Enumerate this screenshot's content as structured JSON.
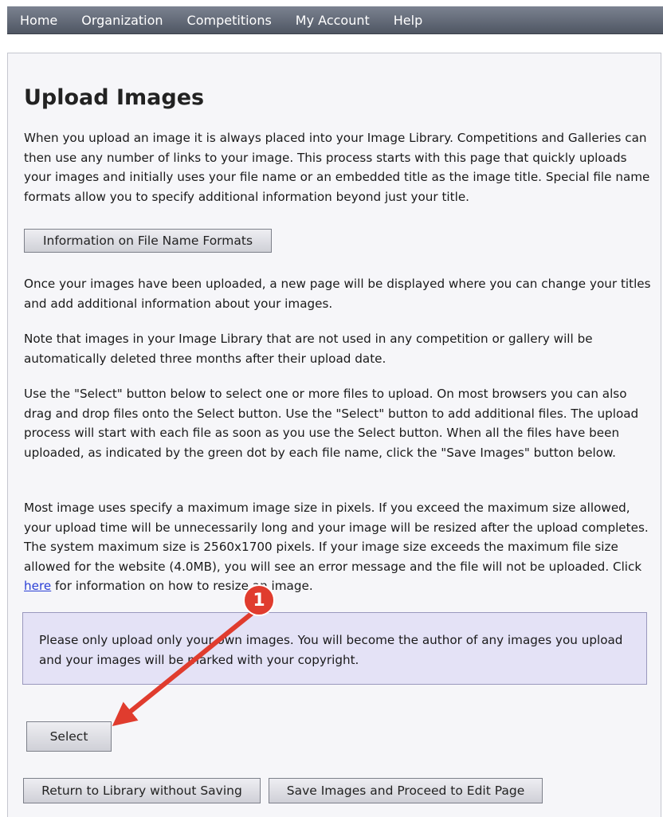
{
  "nav": {
    "items": [
      "Home",
      "Organization",
      "Competitions",
      "My Account",
      "Help"
    ]
  },
  "page": {
    "title": "Upload Images",
    "intro": "When you upload an image it is always placed into your Image Library. Competitions and Galleries can then use any number of links to your image. This process starts with this page that quickly uploads your images and initially uses your file name or an embedded title as the image title. Special file name formats allow you to specify additional information beyond just your title.",
    "info_button": "Information on File Name Formats",
    "para_uploaded": "Once your images have been uploaded, a new page will be displayed where you can change your titles and add additional information about your images.",
    "para_note_delete": "Note that images in your Image Library that are not used in any competition or gallery will be automatically deleted three months after their upload date.",
    "para_select": "Use the \"Select\" button below to select one or more files to upload. On most browsers you can also drag and drop files onto the Select button. Use the \"Select\" button to add additional files. The upload process will start with each file as soon as you use the Select button. When all the files have been uploaded, as indicated by the green dot by each file name, click the \"Save Images\" button below.",
    "para_size_before": "Most image uses specify a maximum image size in pixels. If you exceed the maximum size allowed, your upload time will be unnecessarily long and your image will be resized after the upload completes. The system maximum size is 2560x1700 pixels. If your image size exceeds the maximum file size allowed for the website (4.0MB), you will see an error message and the file will not be uploaded. Click ",
    "para_size_link": "here",
    "para_size_after": " for information on how to resize an image.",
    "notice": "Please only upload only your own images. You will become the author of any images you upload and your images will be marked with your copyright.",
    "select_button": "Select",
    "return_button": "Return to Library without Saving",
    "save_button": "Save Images and Proceed to Edit Page"
  },
  "annotation": {
    "badge": "1",
    "color": "#e03c2e"
  }
}
